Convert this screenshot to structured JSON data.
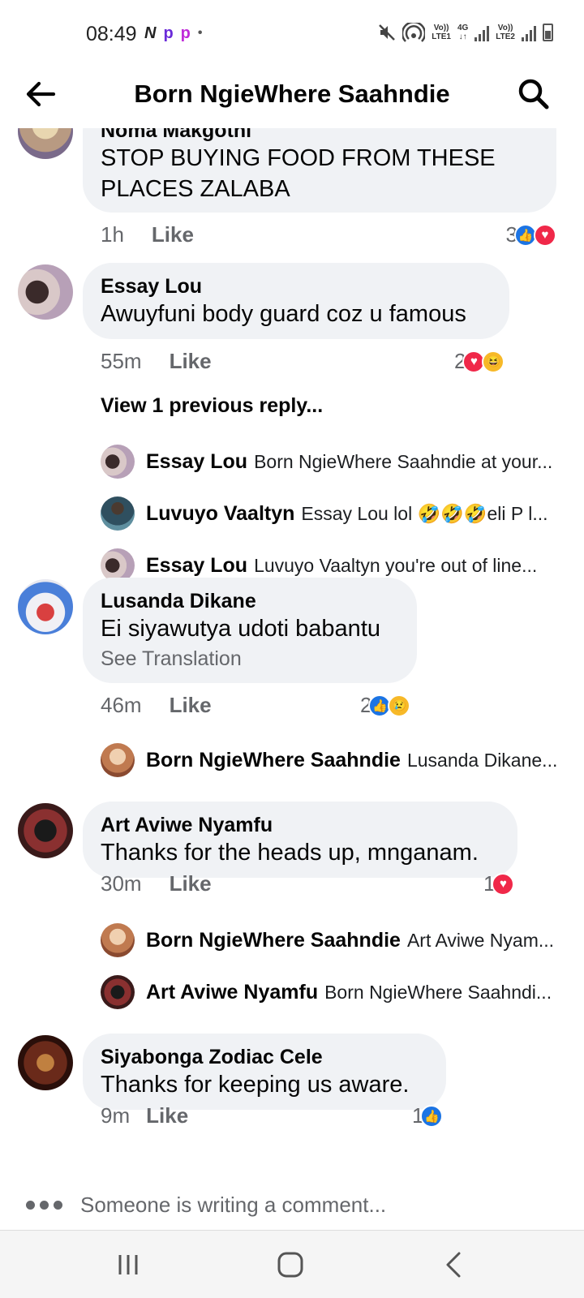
{
  "status": {
    "time": "08:49",
    "left_icons": [
      "N",
      "p",
      "p",
      "•"
    ],
    "net1": [
      "Vo))",
      "LTE1"
    ],
    "net_4g": [
      "4G",
      "↓↑"
    ],
    "net2": [
      "Vo))",
      "LTE2"
    ]
  },
  "header": {
    "title": "Born NgieWhere Saahndie"
  },
  "comments": [
    {
      "name": "Noma Makgothi",
      "text": "STOP BUYING FOOD FROM THESE PLACES ZALABA",
      "time": "1h",
      "like": "Like",
      "reaction_count": "3",
      "reactions": [
        "like",
        "love"
      ]
    },
    {
      "name": "Essay Lou",
      "text": "Awuyfuni body guard coz u famous",
      "time": "55m",
      "like": "Like",
      "reaction_count": "2",
      "reactions": [
        "love",
        "haha"
      ],
      "view_previous": "View 1 previous reply...",
      "replies": [
        {
          "name": "Essay Lou",
          "text": "Born NgieWhere Saahndie at your..."
        },
        {
          "name": "Luvuyo Vaaltyn",
          "text": "Essay Lou lol 🤣🤣🤣eli P l..."
        },
        {
          "name": "Essay Lou",
          "text": "Luvuyo Vaaltyn you're out of line..."
        }
      ]
    },
    {
      "name": "Lusanda Dikane",
      "text": "Ei siyawutya udoti babantu",
      "translation": "See Translation",
      "time": "46m",
      "like": "Like",
      "reaction_count": "2",
      "reactions": [
        "like",
        "sad"
      ],
      "replies": [
        {
          "name": "Born NgieWhere Saahndie",
          "text": "Lusanda Dikane..."
        }
      ]
    },
    {
      "name": "Art Aviwe Nyamfu",
      "text": "Thanks for the heads up, mnganam.",
      "time": "30m",
      "like": "Like",
      "reaction_count": "1",
      "reactions": [
        "love"
      ],
      "replies": [
        {
          "name": "Born NgieWhere Saahndie",
          "text": "Art Aviwe Nyam..."
        },
        {
          "name": "Art Aviwe Nyamfu",
          "text": "Born NgieWhere Saahndi..."
        }
      ]
    },
    {
      "name": "Siyabonga Zodiac Cele",
      "text": "Thanks for keeping us aware.",
      "time": "9m",
      "like": "Like",
      "reaction_count": "1",
      "reactions": [
        "like"
      ]
    }
  ],
  "writing_indicator": "Someone is writing a comment...",
  "icons": {
    "back": "arrow-left-icon",
    "search": "search-icon",
    "recents": "recents-icon",
    "home": "home-icon",
    "back_nav": "chevron-left-icon"
  }
}
